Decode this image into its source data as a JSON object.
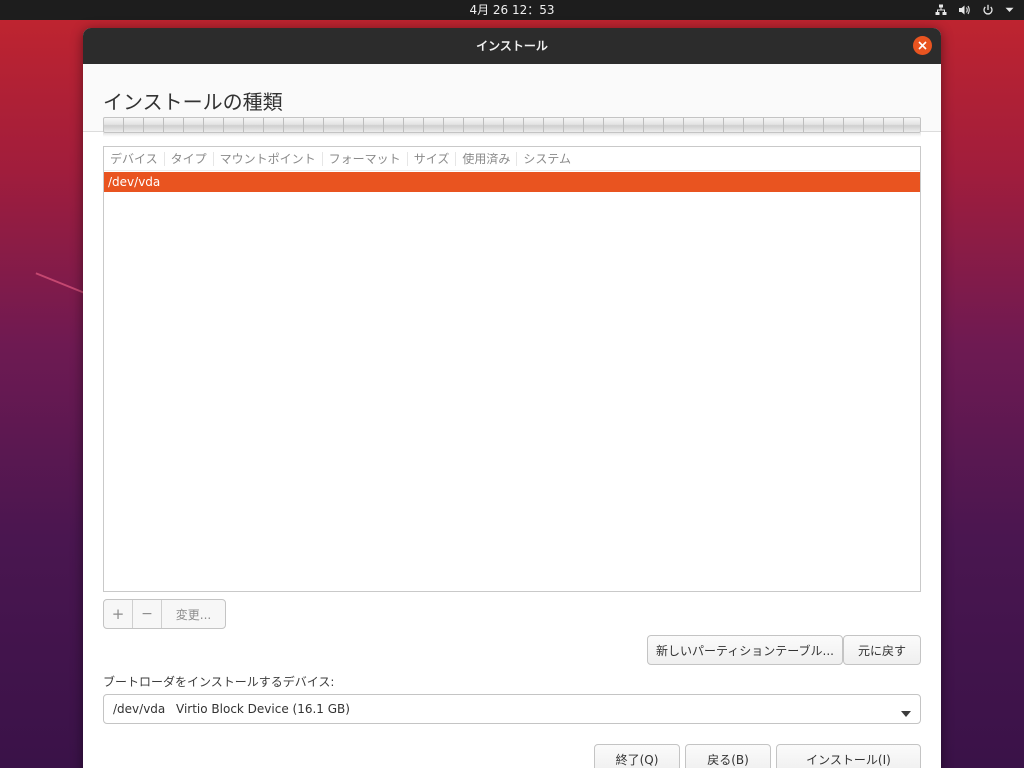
{
  "topbar": {
    "clock": "4月 26  12：53",
    "icons": [
      "network-icon",
      "volume-icon",
      "power-icon",
      "chevron-down-icon"
    ]
  },
  "window": {
    "title": "インストール",
    "close_icon": "close-icon"
  },
  "page": {
    "title": "インストールの種類"
  },
  "partition_table": {
    "columns": [
      "デバイス",
      "タイプ",
      "マウントポイント",
      "フォーマット",
      "サイズ",
      "使用済み",
      "システム"
    ],
    "rows": [
      {
        "device": "/dev/vda",
        "selected": true
      }
    ]
  },
  "toolbar": {
    "add_label": "+",
    "remove_label": "−",
    "change_label": "変更...",
    "new_table_label": "新しいパーティションテーブル...",
    "revert_label": "元に戻す"
  },
  "bootloader": {
    "label": "ブートローダをインストールするデバイス:",
    "selected_device": "/dev/vda",
    "selected_desc": "Virtio Block Device (16.1 GB)"
  },
  "footer": {
    "quit_label": "終了(Q)",
    "back_label": "戻る(B)",
    "install_label": "インストール(I)"
  },
  "colors": {
    "accent": "#e95420",
    "titlebar": "#2c2c2c",
    "topbar": "#1d1d1d"
  }
}
